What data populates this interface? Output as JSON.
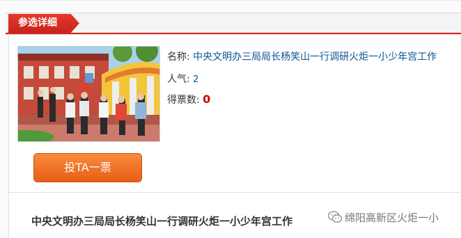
{
  "header": {
    "tab_label": "参选详细"
  },
  "details": {
    "name_label": "名称:",
    "name_value": "中央文明办三局局长杨笑山一行调研火炬一小少年宫工作",
    "popularity_label": "人气:",
    "popularity_value": "2",
    "votes_label": "得票数:",
    "votes_value": "0"
  },
  "vote_button": {
    "label": "投TA一票"
  },
  "article": {
    "title": "中央文明办三局局长杨笑山一行调研火炬一小少年宫工作"
  },
  "watermark": {
    "text": "绵阳高新区火炬一小",
    "icon": "wechat-icon"
  },
  "colors": {
    "accent_red": "#d2261e",
    "button_orange": "#f07a2c",
    "link_blue": "#0b5394"
  }
}
